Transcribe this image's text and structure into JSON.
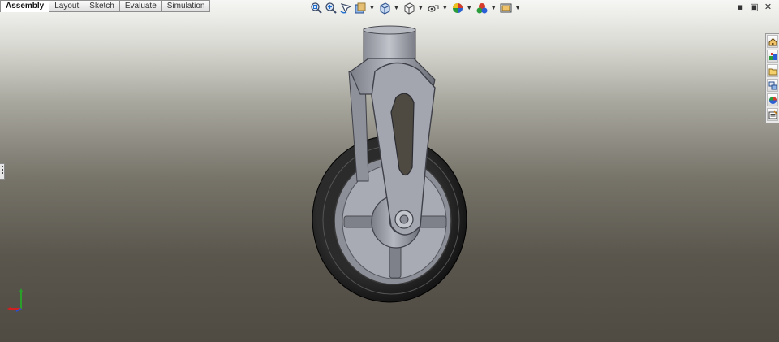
{
  "tabs": [
    {
      "label": "Assembly",
      "active": true
    },
    {
      "label": "Layout",
      "active": false
    },
    {
      "label": "Sketch",
      "active": false
    },
    {
      "label": "Evaluate",
      "active": false
    },
    {
      "label": "Simulation",
      "active": false
    }
  ],
  "heads_up_toolbar": {
    "icons": [
      "zoom-to-fit-icon",
      "zoom-to-area-icon",
      "previous-view-icon",
      "section-view-icon",
      "view-orientation-icon",
      "display-style-icon",
      "hide-show-items-icon",
      "edit-appearance-icon",
      "apply-scene-icon",
      "view-settings-icon"
    ]
  },
  "window_controls": {
    "minimize": "▪",
    "restore": "▣",
    "close": "✕"
  },
  "task_pane": {
    "icons": [
      "home-icon",
      "design-library-icon",
      "file-explorer-icon",
      "view-palette-icon",
      "appearances-icon",
      "custom-properties-icon"
    ]
  },
  "colors": {
    "accent": "#1f6fd0",
    "tire": "#1a1a1a",
    "part_metal": "#9a9ca6",
    "triad_x": "#d21f1f",
    "triad_y": "#2aa02a",
    "triad_z": "#2a4fd2"
  }
}
